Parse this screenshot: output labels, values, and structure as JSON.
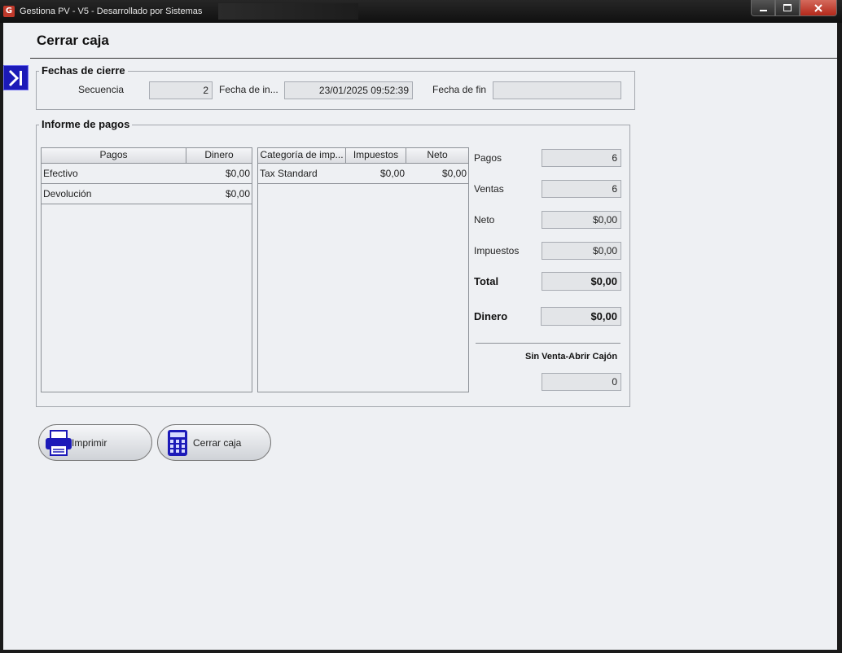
{
  "window": {
    "title": "Gestiona PV - V5 - Desarrollado por Sistemas",
    "app_icon_letter": "G",
    "controls": [
      "minimize",
      "maximize",
      "close"
    ]
  },
  "page": {
    "title": "Cerrar caja"
  },
  "fechas": {
    "legend": "Fechas de cierre",
    "secuencia_label": "Secuencia",
    "secuencia_value": "2",
    "fecha_inicio_label": "Fecha de in...",
    "fecha_inicio_value": "23/01/2025 09:52:39",
    "fecha_fin_label": "Fecha de fin",
    "fecha_fin_value": ""
  },
  "informe": {
    "legend": "Informe de pagos",
    "pagos_table": {
      "columns": [
        "Pagos",
        "Dinero"
      ],
      "rows": [
        {
          "pago": "Efectivo",
          "dinero": "$0,00"
        },
        {
          "pago": "Devolución",
          "dinero": "$0,00"
        }
      ]
    },
    "impuestos_table": {
      "columns": [
        "Categoría de imp...",
        "Impuestos",
        "Neto"
      ],
      "rows": [
        {
          "categoria": "Tax Standard",
          "impuestos": "$0,00",
          "neto": "$0,00"
        }
      ]
    },
    "summary": {
      "pagos_label": "Pagos",
      "pagos_value": "6",
      "ventas_label": "Ventas",
      "ventas_value": "6",
      "neto_label": "Neto",
      "neto_value": "$0,00",
      "impuestos_label": "Impuestos",
      "impuestos_value": "$0,00",
      "total_label": "Total",
      "total_value": "$0,00",
      "dinero_label": "Dinero",
      "dinero_value": "$0,00",
      "sin_venta_label": "Sin Venta-Abrir Cajón",
      "sin_venta_value": "0"
    }
  },
  "actions": {
    "imprimir_label": "Imprimir",
    "cerrar_label": "Cerrar caja"
  },
  "icons": {
    "side_button": "collapse-panel-icon",
    "imprimir": "printer-icon",
    "cerrar": "calculator-icon"
  },
  "colors": {
    "accent": "#1c1ab8",
    "background": "#eef0f3"
  }
}
